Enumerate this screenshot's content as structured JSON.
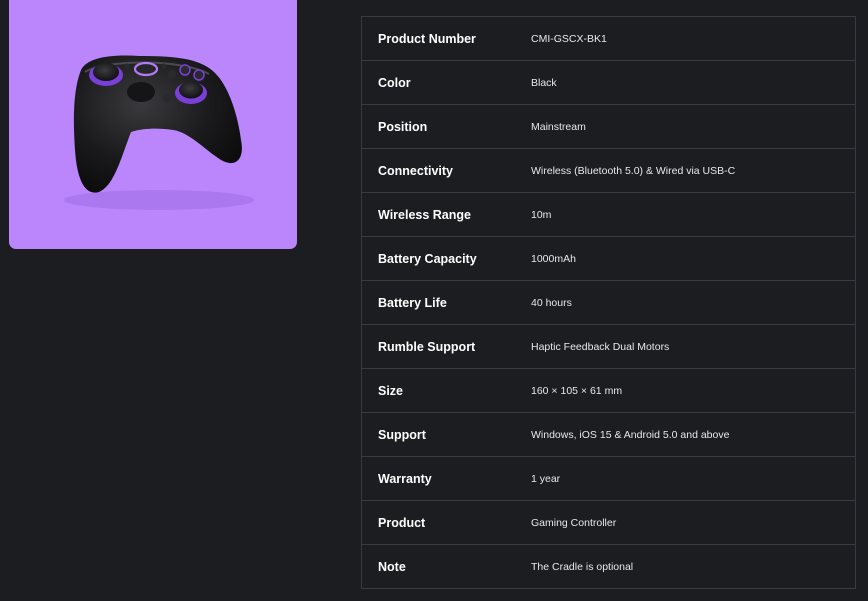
{
  "product_image": {
    "alt": "Gaming Controller",
    "background_color": "#bb86fc",
    "accent_color": "#7a3fd6"
  },
  "specs": [
    {
      "label": "Product Number",
      "value": "CMI-GSCX-BK1"
    },
    {
      "label": "Color",
      "value": "Black"
    },
    {
      "label": "Position",
      "value": "Mainstream"
    },
    {
      "label": "Connectivity",
      "value": "Wireless (Bluetooth 5.0) & Wired via USB-C"
    },
    {
      "label": "Wireless Range",
      "value": "10m"
    },
    {
      "label": "Battery Capacity",
      "value": "1000mAh"
    },
    {
      "label": "Battery Life",
      "value": "40 hours"
    },
    {
      "label": "Rumble Support",
      "value": "Haptic Feedback Dual Motors"
    },
    {
      "label": "Size",
      "value": "160 × 105 × 61 mm"
    },
    {
      "label": "Support",
      "value": "Windows, iOS 15 & Android 5.0 and above"
    },
    {
      "label": "Warranty",
      "value": "1 year"
    },
    {
      "label": "Product",
      "value": "Gaming Controller"
    },
    {
      "label": "Note",
      "value": "The Cradle is optional"
    }
  ],
  "colors": {
    "page_background": "#1c1d21",
    "table_border": "#3a3b42",
    "label_text": "#ffffff"
  }
}
